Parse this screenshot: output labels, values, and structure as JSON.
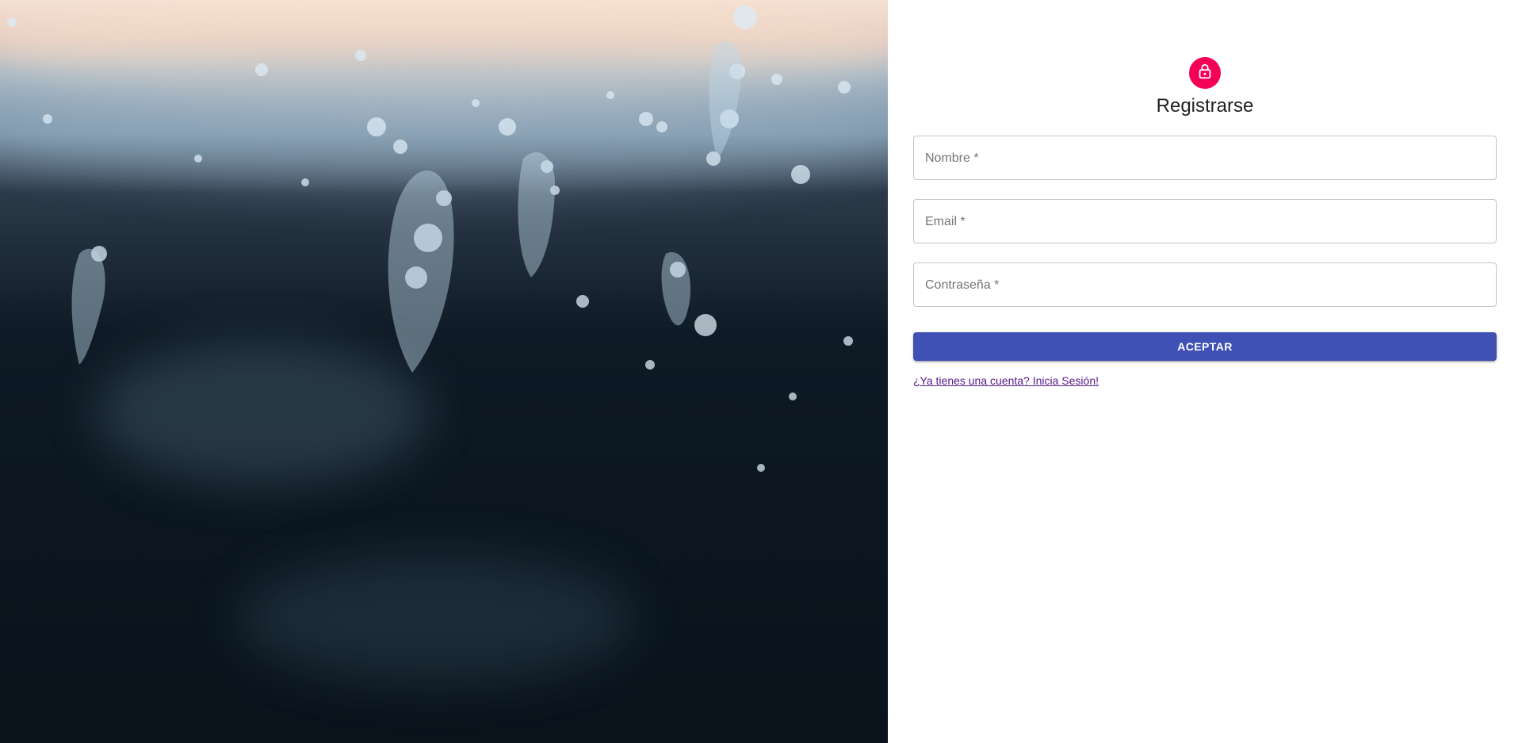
{
  "form": {
    "title": "Registrarse",
    "name_label": "Nombre *",
    "email_label": "Email *",
    "password_label": "Contraseña *",
    "submit_label": "ACEPTAR",
    "login_link": "¿Ya tienes una cuenta? Inicia Sesión!"
  },
  "icons": {
    "avatar": "lock-icon"
  },
  "colors": {
    "avatar_bg": "#f50057",
    "primary": "#3f51b5",
    "link": "#551a8b"
  }
}
